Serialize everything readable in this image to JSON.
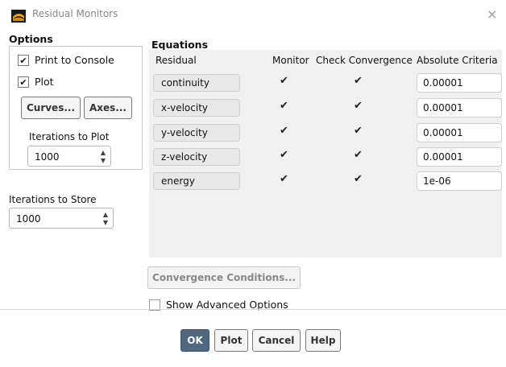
{
  "window": {
    "title": "Residual Monitors",
    "close_glyph": "×"
  },
  "options": {
    "heading": "Options",
    "print_to_console": {
      "label": "Print to Console",
      "checked": true
    },
    "plot": {
      "label": "Plot",
      "checked": true
    },
    "curves_button": "Curves...",
    "axes_button": "Axes...",
    "iterations_to_plot": {
      "label": "Iterations to Plot",
      "value": "1000"
    }
  },
  "iterations_to_store": {
    "label": "Iterations to Store",
    "value": "1000"
  },
  "equations": {
    "heading": "Equations",
    "columns": {
      "residual": "Residual",
      "monitor": "Monitor",
      "check": "Check Convergence",
      "criteria": "Absolute Criteria"
    },
    "rows": [
      {
        "residual": "continuity",
        "monitor": true,
        "check": true,
        "criteria": "0.00001"
      },
      {
        "residual": "x-velocity",
        "monitor": true,
        "check": true,
        "criteria": "0.00001"
      },
      {
        "residual": "y-velocity",
        "monitor": true,
        "check": true,
        "criteria": "0.00001"
      },
      {
        "residual": "z-velocity",
        "monitor": true,
        "check": true,
        "criteria": "0.00001"
      },
      {
        "residual": "energy",
        "monitor": true,
        "check": true,
        "criteria": "1e-06"
      }
    ]
  },
  "convergence_conditions_button": "Convergence Conditions...",
  "show_advanced": {
    "label": "Show Advanced Options",
    "checked": false
  },
  "footer": {
    "ok": "OK",
    "plot": "Plot",
    "cancel": "Cancel",
    "help": "Help"
  },
  "check_glyph": "✔",
  "icons": {
    "window": "fluent-logo-icon",
    "spin": "spinner-arrows-icon"
  }
}
